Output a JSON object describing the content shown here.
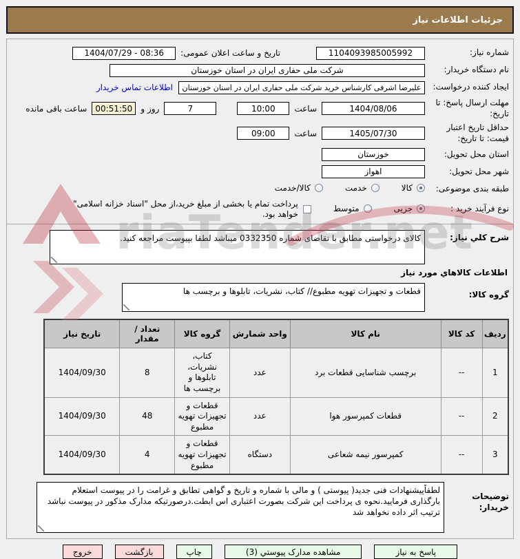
{
  "header": {
    "title": "جزئیات اطلاعات نیاز"
  },
  "form": {
    "need_number": {
      "label": "شماره نیاز:",
      "value": "1104093985005992"
    },
    "announce_datetime": {
      "label": "تاریخ و ساعت اعلان عمومی:",
      "value": "1404/07/29 - 08:36"
    },
    "buyer_org": {
      "label": "نام دستگاه خریدار:",
      "value": "شرکت ملی حفاری ایران در استان خوزستان"
    },
    "request_creator": {
      "label": "ایجاد کننده درخواست:",
      "value": "علیرضا اشرفی کارشناس خرید شرکت ملی حفاری ایران در استان خوزستان",
      "contact_link": "اطلاعات تماس خریدار"
    },
    "response_deadline": {
      "label": "مهلت ارسال پاسخ: تا تاریخ:",
      "date": "1404/08/06",
      "hour_label": "ساعت",
      "time": "10:00",
      "days_value": "7",
      "days_label": "روز و",
      "countdown": "00:51:50",
      "remaining_label": "ساعت باقی مانده"
    },
    "price_validity": {
      "label": "حداقل تاریخ اعتبار قیمت: تا تاریخ:",
      "date": "1405/07/30",
      "hour_label": "ساعت",
      "time": "09:00"
    },
    "province": {
      "label": "استان محل تحویل:",
      "value": "خوزستان"
    },
    "city": {
      "label": "شهر محل تحویل:",
      "value": "اهواز"
    },
    "classification": {
      "label": "طبقه بندی موضوعی:",
      "options": [
        {
          "label": "کالا",
          "selected": true
        },
        {
          "label": "خدمت",
          "selected": false
        },
        {
          "label": "کالا/خدمت",
          "selected": false
        }
      ]
    },
    "purchase_process": {
      "label": "نوع فرآیند خرید :",
      "options": [
        {
          "label": "جزیی",
          "selected": true
        },
        {
          "label": "متوسط",
          "selected": false
        }
      ],
      "checkbox_label": "پرداخت تمام یا بخشی از مبلغ خرید،از محل \"اسناد خزانه اسلامی\" خواهد بود.",
      "checkbox_checked": false
    }
  },
  "need_description": {
    "label": "شرح کلي نیاز:",
    "value": "کالای درخواستی مطابق با تقاضای شماره 0332350 میباشد لطفا بپیوست مراجعه کنید."
  },
  "goods_section": {
    "title": "اطلاعات کالاهاي مورد نیاز",
    "group": {
      "label": "گروه کالا:",
      "value": "قطعات و تجهیزات تهویه مطبوع// کتاب، نشریات، تابلوها و برچسب ها"
    },
    "table": {
      "headers": [
        "ردیف",
        "کد کالا",
        "نام کالا",
        "واحد شمارش",
        "گروه کالا",
        "تعداد / مقدار",
        "تاریخ نیاز"
      ],
      "rows": [
        [
          "1",
          "--",
          "برچسب شناسایی قطعات برد",
          "عدد",
          "کتاب، نشریات، تابلوها و برچسب ها",
          "8",
          "1404/09/30"
        ],
        [
          "2",
          "--",
          "قطعات کمپرسور هوا",
          "عدد",
          "قطعات و تجهیزات تهویه مطبوع",
          "48",
          "1404/09/30"
        ],
        [
          "3",
          "--",
          "کمپرسور نیمه شعاعی",
          "دستگاه",
          "قطعات و تجهیزات تهویه مطبوع",
          "4",
          "1404/09/30"
        ]
      ]
    }
  },
  "buyer_notes": {
    "label": "توضیحات خریدار:",
    "value": "لطفاًپیشنهادات فنی جدید( پیوستی ) و مالی با شماره و تاریخ و گواهی تطابق و غرامت را در پیوست استعلام بارگذاری فرمایید.نحوه ی پرداخت این شرکت بصورت اعتباری اس ابطت.درصورتیکه مدارک مذکور در پیوست نباشد ترتیب اثر داده نخواهد شد"
  },
  "buttons": [
    {
      "name": "respond-button",
      "label": "پاسخ به نیاز",
      "style": "green wide"
    },
    {
      "name": "view-attachments-button",
      "label": "مشاهده مدارک پیوستي (3)",
      "style": "green wide"
    },
    {
      "name": "print-button",
      "label": "چاپ",
      "style": "green"
    },
    {
      "name": "back-button",
      "label": "بازگشت",
      "style": "pink"
    },
    {
      "name": "exit-button",
      "label": "خروج",
      "style": "pink"
    }
  ],
  "watermark": {
    "text": "riaTender.net"
  },
  "colors": {
    "bg": "#EFEFEF",
    "brown": "#9B7B4D",
    "link": "#0000CC",
    "yellow": "#F5F1D3",
    "green": "#E6F8E6",
    "pink": "#F9D9D9",
    "tableHeader": "#C8C8C8"
  }
}
